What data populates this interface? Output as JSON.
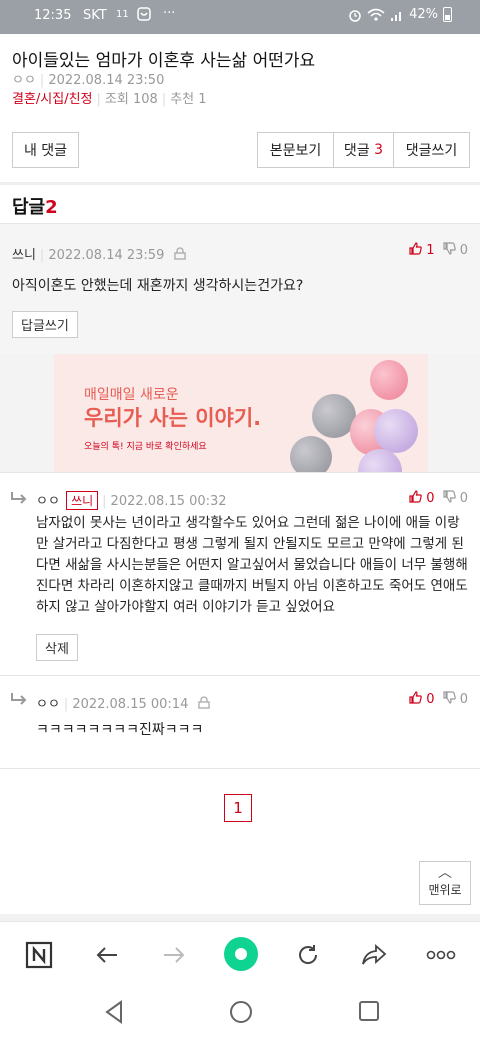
{
  "status_bar": {
    "time": "12:35",
    "carrier": "SKT",
    "extra": "11",
    "battery": "42%"
  },
  "post": {
    "title": "아이들있는 엄마가 이혼후 사는삶 어떤가요",
    "author": "ㅇㅇ",
    "date": "2022.08.14 23:50",
    "category": "결혼/시집/친정",
    "views": "조회 108",
    "recommend": "추천 1"
  },
  "buttons": {
    "my_comments": "내 댓글",
    "view_post": "본문보기",
    "comments_label": "댓글",
    "comments_count": "3",
    "write_comment": "댓글쓰기"
  },
  "replies": {
    "label": "답글",
    "count": "2"
  },
  "comments": [
    {
      "author": "쓰니",
      "date": "2022.08.14 23:59",
      "up": "1",
      "down": "0",
      "text": "아직이혼도 안했는데 재혼까지 생각하시는건가요?",
      "action": "답글쓰기"
    },
    {
      "author": "ㅇㅇ",
      "badge": "쓰니",
      "date": "2022.08.15 00:32",
      "up": "0",
      "down": "0",
      "text": "남자없이 못사는 년이라고 생각할수도 있어요 그런데 젊은 나이에 애들 이랑만 살거라고 다짐한다고 평생 그렇게 될지 안될지도 모르고 만약에 그렇게 된다면 새삶을 사시는분들은 어떤지 알고싶어서 물었습니다 애들이 너무 불행해진다면 차라리 이혼하지않고 클때까지 버틸지 아님 이혼하고도 죽어도 연애도하지 않고 살아가야할지 여러 이야기가 듣고 싶었어요",
      "action": "삭제"
    },
    {
      "author": "ㅇㅇ",
      "date": "2022.08.15 00:14",
      "up": "0",
      "down": "0",
      "text": "ㅋㅋㅋㅋㅋㅋㅋㅋ진짜ㅋㅋㅋ"
    }
  ],
  "ad": {
    "line1": "매일매일 새로운",
    "line2": "우리가 사는 이야기.",
    "line3": "오늘의 톡! 지금 바로 확인하세요"
  },
  "pagination": {
    "current": "1"
  },
  "scroll_top": "맨위로",
  "colors": {
    "accent": "#d0021b"
  }
}
